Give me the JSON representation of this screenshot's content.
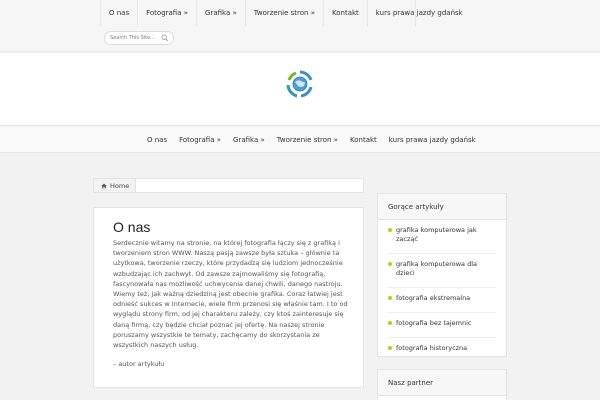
{
  "top_nav": {
    "items": [
      {
        "label": "O nas"
      },
      {
        "label": "Fotografia »"
      },
      {
        "label": "Grafika »"
      },
      {
        "label": "Tworzenie stron »"
      },
      {
        "label": "Kontakt"
      },
      {
        "label": "kurs prawa jazdy gdańsk"
      }
    ]
  },
  "search": {
    "placeholder": "Search This Site..."
  },
  "main_nav": {
    "items": [
      {
        "label": "O nas"
      },
      {
        "label": "Fotografia »"
      },
      {
        "label": "Grafika »"
      },
      {
        "label": "Tworzenie stron »"
      },
      {
        "label": "Kontakt"
      },
      {
        "label": "kurs prawa jazdy gdańsk"
      }
    ]
  },
  "breadcrumb": {
    "home_label": "Home"
  },
  "article": {
    "title": "O nas",
    "body": "Serdecznie witamy na stronie, na której fotografia łączy się z grafiką i tworzeniem stron WWW. Naszą pasją zawsze była sztuka – głównie ta użytkowa, tworzenie rzeczy, które przydadzą się ludziom jednocześnie wzbudzając ich zachwyt. Od zawsze zajmowaliśmy się fotografią, fascynowała nas możliwość uchwycenia danej chwili, danego nastroju. Wiemy też, jak ważną dziedziną jest obecnie grafika. Coraz łatwiej jest odnieść sukces w Internecie, wiele firm przenosi się właśnie tam. I to od wyglądu strony firm, od jej charakteru zależy, czy ktoś zainteresuje się daną firmą, czy będzie chciał poznać jej ofertę. Na naszej stronie poruszamy wszystkie te tematy, zachęcamy do skorzystania ze wszystkich naszych usług.",
    "author": "– autor artykułu"
  },
  "sidebar": {
    "hot_title": "Gorące artykuły",
    "hot_items": [
      {
        "label": "grafika komputerowa jak zacząć"
      },
      {
        "label": "grafika komputerowa dla dzieci"
      },
      {
        "label": "fotografia ekstremalna"
      },
      {
        "label": "fotografia bez tajemnic"
      },
      {
        "label": "fotografia historyczna"
      }
    ],
    "partner_title": "Nasz partner"
  },
  "colors": {
    "accent_dot": "#b4cf1d",
    "logo_blue": "#3a8fc9",
    "logo_green": "#79b32a"
  },
  "icons": {
    "search": "search-icon",
    "home": "home-icon",
    "logo": "globe-logo-icon"
  }
}
